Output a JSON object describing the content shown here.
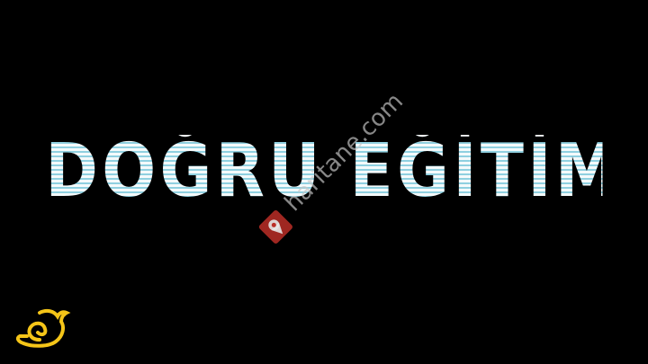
{
  "title": "DOĞRU EĞİTİM",
  "watermark": {
    "text": "haritane.com",
    "icon": "map-pin-icon",
    "color": "#d0342c"
  },
  "logo": {
    "icon": "snail-logo-icon",
    "color": "#f5c518"
  },
  "colors": {
    "background": "#000000",
    "title_light": "#f4fafb",
    "title_stripe": "#8fd0e0"
  }
}
